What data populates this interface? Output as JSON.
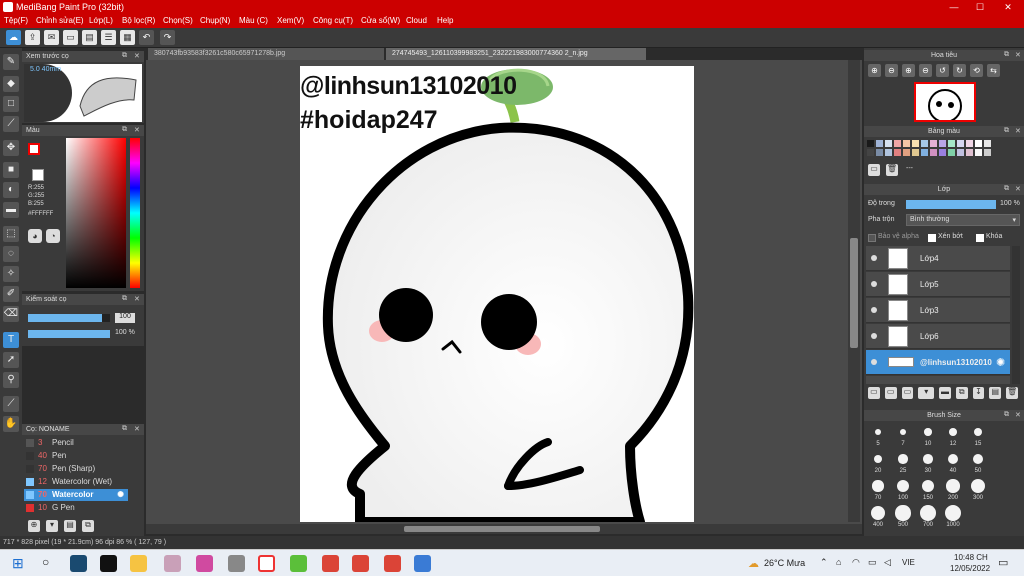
{
  "window": {
    "title": "MediBang Paint Pro (32bit)",
    "minimize": "—",
    "maximize": "☐",
    "close": "✕"
  },
  "menu": [
    "Tệp(F)",
    "Chỉnh sửa(E)",
    "Lớp(L)",
    "Bộ lọc(R)",
    "Chọn(S)",
    "Chụp(N)",
    "Màu (C)",
    "Xem(V)",
    "Công cụ(T)",
    "Cửa sổ(W)",
    "Cloud",
    "Help"
  ],
  "tabs": [
    {
      "label": "380743fb93583f3261c580c65971278b.jpg"
    },
    {
      "label": "274745493_126110399983251_232221983000774360 2_n.jpg"
    }
  ],
  "brush_preview": {
    "title": "Xem trước cọ",
    "size_label": "5.0 40mm"
  },
  "color_panel": {
    "title": "Màu",
    "r": "R:255",
    "g": "G:255",
    "b": "B:255",
    "hex": "#FFFFFF",
    "primary": "#ffffff",
    "secondary": "#ff0000"
  },
  "brush_control": {
    "title": "Kiểm soát cọ",
    "size_value": "100",
    "opacity_value": "100 %",
    "size_fraction": 0.9,
    "opacity_fraction": 1.0
  },
  "brush_list": {
    "title": "Cọ: NONAME",
    "items": [
      {
        "size": "3",
        "name": "Pencil",
        "color": "#555555"
      },
      {
        "size": "40",
        "name": "Pen",
        "color": "#333333"
      },
      {
        "size": "70",
        "name": "Pen (Sharp)",
        "color": "#333333"
      },
      {
        "size": "12",
        "name": "Watercolor (Wet)",
        "color": "#7fc7ff"
      },
      {
        "size": "70",
        "name": "Watercolor",
        "color": "#7fc7ff"
      },
      {
        "size": "10",
        "name": "G Pen",
        "color": "#e03030"
      }
    ]
  },
  "canvas": {
    "text_line1": "@linhsun13102010",
    "text_line2": "#hoidap247"
  },
  "navigator": {
    "title": "Hoa tiêu"
  },
  "palette": {
    "title": "Bảng màu",
    "dash": "---"
  },
  "layer_panel": {
    "title": "Lớp",
    "opacity_label": "Độ trong",
    "opacity_value": "100 %",
    "opacity_fraction": 1.0,
    "blend_label": "Pha trộn",
    "blend_value": "Bình thường",
    "protect_alpha": "Bảo vệ alpha",
    "clipping": "Xén bớt",
    "lock": "Khóa",
    "layers": [
      {
        "name": "Lớp4"
      },
      {
        "name": "Lớp5"
      },
      {
        "name": "Lớp3"
      },
      {
        "name": "Lớp6"
      },
      {
        "name": "@linhsun13102010"
      }
    ]
  },
  "brush_size": {
    "title": "Brush Size",
    "sizes": [
      "5",
      "7",
      "10",
      "12",
      "15",
      "20",
      "25",
      "30",
      "40",
      "50",
      "70",
      "100",
      "150",
      "200",
      "300",
      "400",
      "500",
      "700",
      "1000"
    ]
  },
  "status": {
    "text": "717 * 828 pixel   (19 * 21.9cm)   96 dpi   86 %   ( 127, 79 )"
  },
  "taskbar": {
    "weather": "26°C  Mưa",
    "lang": "VIE",
    "time": "10:48 CH",
    "date": "12/05/2022"
  }
}
